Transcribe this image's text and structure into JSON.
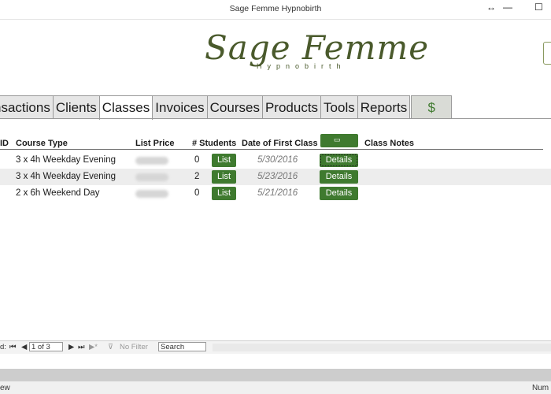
{
  "window": {
    "title": "Sage Femme Hypnobirth",
    "restore_glyph": "↔",
    "minimize_glyph": "—",
    "maximize_glyph": "☐"
  },
  "logo": {
    "main": "Sage Femme",
    "sub": "Hypnobirth"
  },
  "tabs": [
    {
      "label": "nsactions"
    },
    {
      "label": "Clients"
    },
    {
      "label": "Classes",
      "active": true
    },
    {
      "label": "Invoices"
    },
    {
      "label": "Courses"
    },
    {
      "label": "Products"
    },
    {
      "label": "Tools"
    },
    {
      "label": "Reports"
    },
    {
      "label": "$"
    }
  ],
  "table": {
    "headers": {
      "id": "ID",
      "course_type": "Course Type",
      "list_price": "List Price",
      "students": "# Students",
      "first_class": "Date of First Class",
      "notes": "Class Notes"
    },
    "header_button_icon": "add-record-icon",
    "rows": [
      {
        "course_type": "3 x 4h Weekday Evening",
        "students": "0",
        "list_label": "List",
        "date": "5/30/2016",
        "details_label": "Details"
      },
      {
        "course_type": "3 x 4h Weekday Evening",
        "students": "2",
        "list_label": "List",
        "date": "5/23/2016",
        "details_label": "Details"
      },
      {
        "course_type": "2 x 6h Weekend Day",
        "students": "0",
        "list_label": "List",
        "date": "5/21/2016",
        "details_label": "Details"
      }
    ]
  },
  "navigation": {
    "record_label": "d:",
    "first": "⏮",
    "prev": "◀",
    "record_value": "1 of 3",
    "next": "▶",
    "last": "⏭",
    "new": "▶*",
    "filter_label": "No Filter",
    "search_label": "Search"
  },
  "status_bar": {
    "left": "ew",
    "right": "Num"
  },
  "colors": {
    "accent": "#3f7a2f",
    "logo": "#4a5a2c"
  }
}
